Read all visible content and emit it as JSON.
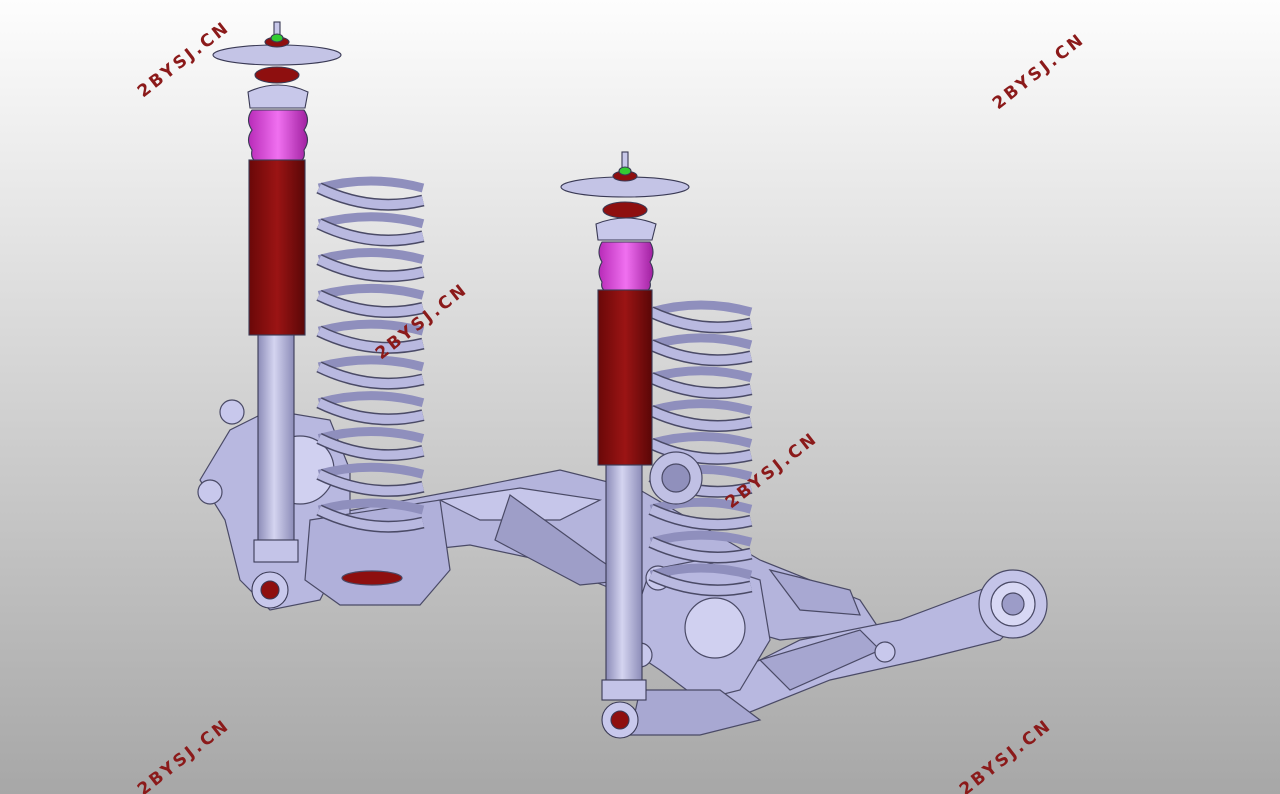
{
  "viewport": {
    "background_top": "#fdfdfd",
    "background_bottom": "#a7a7a7"
  },
  "model": {
    "colors": {
      "body": "#b9b9e0",
      "body_dark": "#8f8fbd",
      "edge": "#4a4a66",
      "damper_red": "#8e0f0f",
      "damper_red_dark": "#5a0707",
      "bellows_magenta": "#e040e0",
      "nut_green": "#33cc33"
    },
    "parts": [
      "left-strut",
      "right-strut",
      "left-coil-spring",
      "right-coil-spring",
      "left-knuckle",
      "right-knuckle",
      "subframe",
      "trailing-arm"
    ]
  },
  "watermarks": [
    {
      "text": "2BYSJ.CN",
      "color": "#8b1a1a"
    },
    {
      "text": "2BYSJ.CN",
      "color": "#8b1a1a"
    },
    {
      "text": "2BYSJ.CN",
      "color": "#8b1a1a"
    },
    {
      "text": "2BYSJ.CN",
      "color": "#8b1a1a"
    },
    {
      "text": "2BYSJ.CN",
      "color": "#8b1a1a"
    },
    {
      "text": "2BYSJ.CN",
      "color": "#8b1a1a"
    }
  ]
}
